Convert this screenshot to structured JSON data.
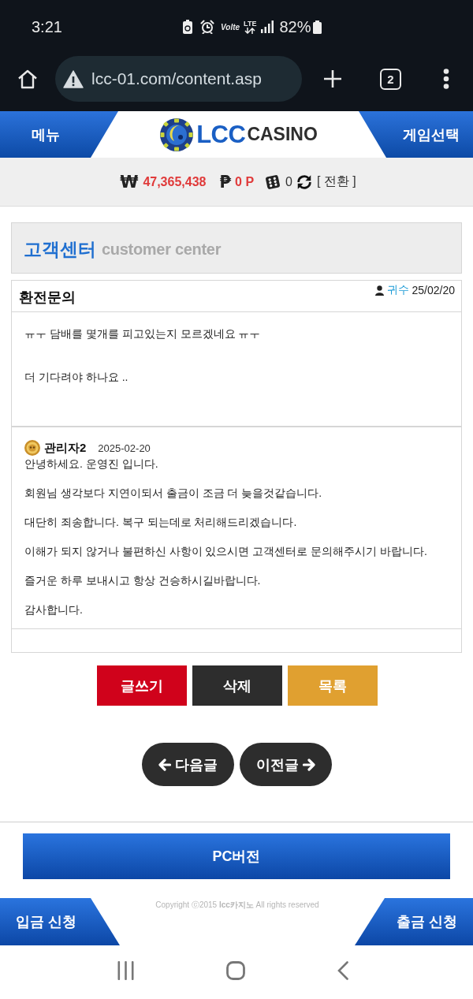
{
  "status_bar": {
    "time": "3:21",
    "volte": "Volte",
    "network": "LTE",
    "battery": "82%"
  },
  "browser": {
    "url": "lcc-01.com/content.asp",
    "tab_count": "2"
  },
  "header": {
    "menu": "메뉴",
    "logo": {
      "brand": "LCC",
      "suffix": "CASINO"
    },
    "game_select": "게임선택"
  },
  "balance": {
    "money_sign": "₩",
    "money": "47,365,438",
    "point_sign": "₱",
    "points": "0 P",
    "chips": "0",
    "exchange": "[ 전환 ]"
  },
  "section": {
    "title": "고객센터",
    "subtitle": "customer center"
  },
  "post": {
    "title": "환전문의",
    "author": "귀수",
    "date": "25/02/20",
    "body": [
      "ㅠㅜ 담배를 몇개를 피고있는지 모르겠네요 ㅠㅜ",
      "더 기다려야 하나요 .."
    ]
  },
  "reply": {
    "author": "관리자2",
    "date": "2025-02-20",
    "lines": [
      "안녕하세요. 운영진 입니다.",
      "회원님 생각보다 지연이되서 출금이 조금 더 늦을것같습니다.",
      "대단히 죄송합니다. 복구 되는데로 처리해드리겠습니다.",
      "이해가 되지 않거나 불편하신 사항이 있으시면 고객센터로 문의해주시기 바랍니다.",
      "즐거운 하루 보내시고 항상 건승하시길바랍니다.",
      "감사합니다."
    ]
  },
  "actions": [
    {
      "kind": "write",
      "label": "글쓰기"
    },
    {
      "kind": "delete",
      "label": "삭제"
    },
    {
      "kind": "list",
      "label": "목록"
    }
  ],
  "pager": [
    {
      "kind": "next",
      "label": "다음글"
    },
    {
      "kind": "previous",
      "label": "이전글"
    }
  ],
  "pc_version": "PC버전",
  "footer": {
    "deposit": "입금 신청",
    "copyright": "Copyright ⓒ2015 **lcc카지노** All rights reserved",
    "withdraw": "출금 신청"
  }
}
